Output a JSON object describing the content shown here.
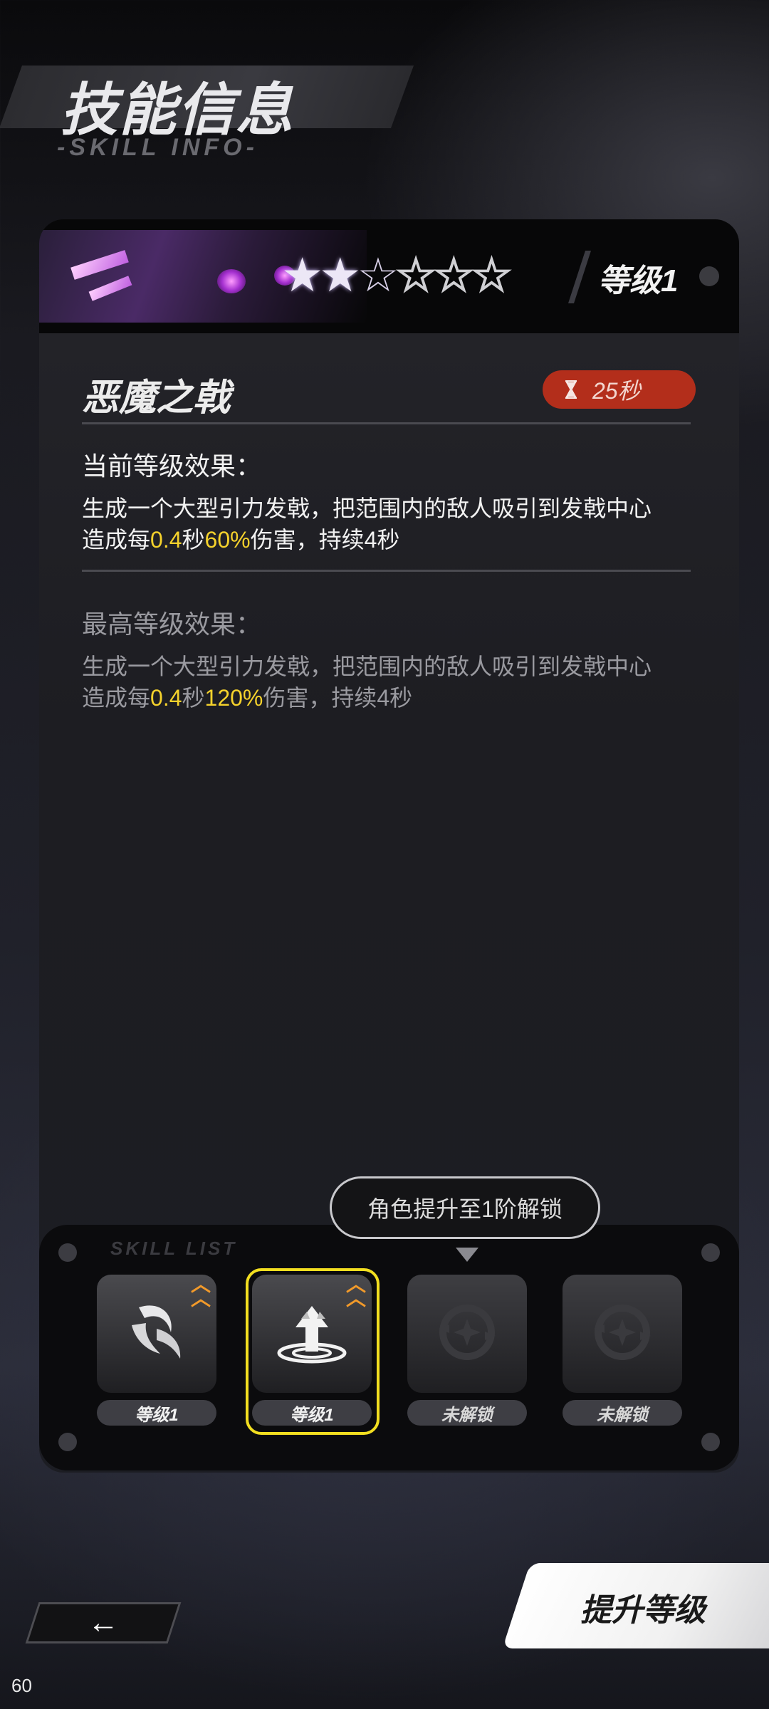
{
  "header": {
    "title": "技能信息",
    "subtitle": "-SKILL INFO-"
  },
  "skill_card": {
    "stars": {
      "filled": 2,
      "total": 6
    },
    "level_label": "等级1",
    "skill_name": "恶魔之戟",
    "cooldown": "25秒",
    "current_effect_label": "当前等级效果：",
    "current_effect": {
      "line1": "生成一个大型引力发戟，把范围内的敌人吸引到发戟中心",
      "line2_prefix": "造成每",
      "interval": "0.4",
      "line2_mid": "秒",
      "damage": "60%",
      "line2_suffix": "伤害，持续4秒"
    },
    "max_effect_label": "最高等级效果：",
    "max_effect": {
      "line1": "生成一个大型引力发戟，把范围内的敌人吸引到发戟中心",
      "line2_prefix": "造成每",
      "interval": "0.4",
      "line2_mid": "秒",
      "damage": "120%",
      "line2_suffix": "伤害，持续4秒"
    }
  },
  "tooltip": "角色提升至1阶解锁",
  "skills_panel": {
    "subtitle": "SKILL LIST",
    "slots": [
      {
        "label": "等级1",
        "icon": "claw-skill-icon",
        "upgradable": true,
        "selected": false
      },
      {
        "label": "等级1",
        "icon": "uplift-skill-icon",
        "upgradable": true,
        "selected": true
      },
      {
        "label": "未解锁",
        "icon": "locked-skill-icon",
        "upgradable": false,
        "selected": false
      },
      {
        "label": "未解锁",
        "icon": "locked-skill-icon",
        "upgradable": false,
        "selected": false
      }
    ]
  },
  "buttons": {
    "back": "←",
    "upgrade": "提升等级"
  },
  "fps": "60",
  "colors": {
    "highlight": "#f5d22c",
    "timer_bg": "#b32e1b",
    "selected_frame": "#f2de20",
    "upgrade_chevron": "#f29a2a"
  }
}
